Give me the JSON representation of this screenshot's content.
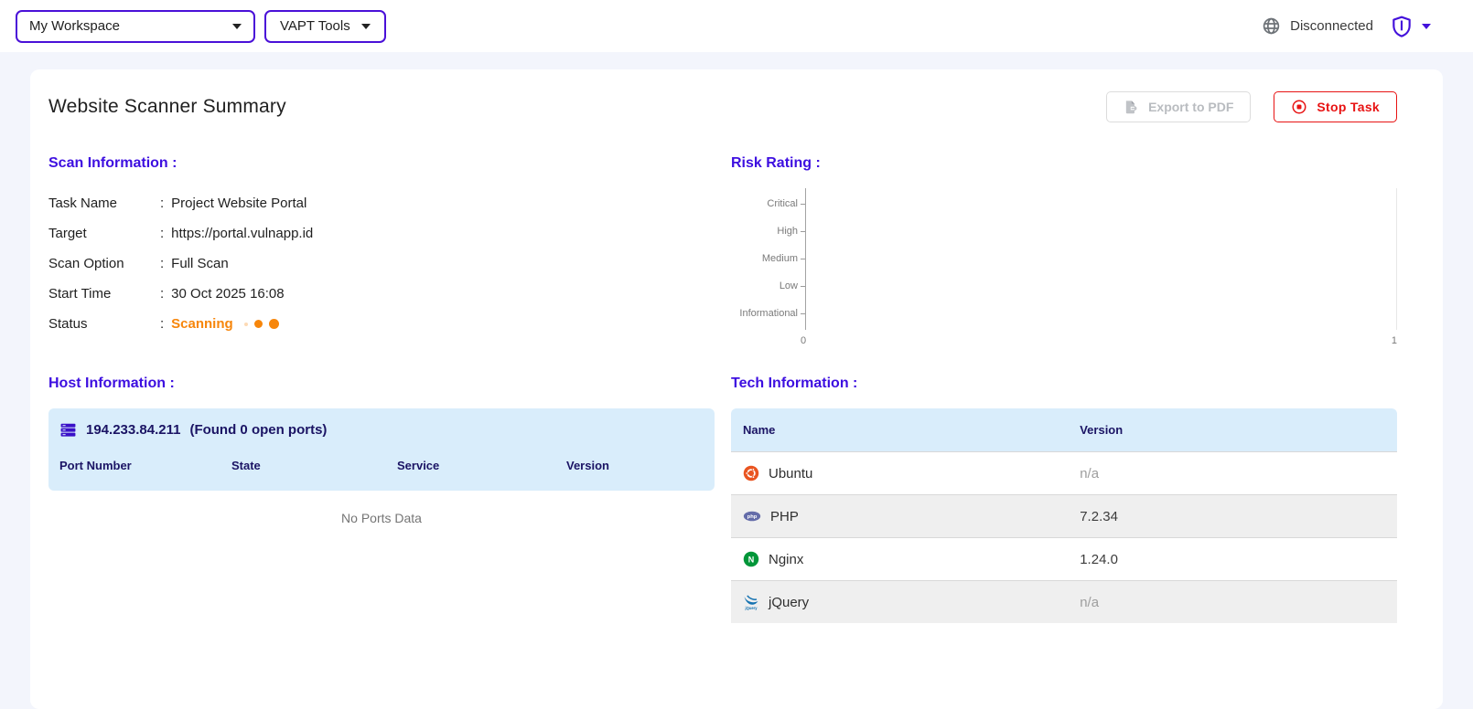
{
  "topbar": {
    "workspace_select": {
      "value": "My Workspace",
      "icon": "chevron-down-icon"
    },
    "vapt_tools_button": {
      "label": "VAPT Tools",
      "icon": "chevron-down-icon"
    },
    "connection": {
      "icon": "globe-icon",
      "status": "Disconnected"
    },
    "account_menu": {
      "icon": "shield-icon",
      "chevron": "chevron-down-icon"
    }
  },
  "header": {
    "title": "Website Scanner Summary",
    "export_button": {
      "label": "Export to PDF",
      "icon": "file-export-icon",
      "enabled": false
    },
    "stop_button": {
      "label": "Stop Task",
      "icon": "stop-circle-icon"
    }
  },
  "scan_info": {
    "heading": "Scan Information :",
    "separator": ":",
    "rows": [
      {
        "label": "Task Name",
        "value": "Project Website Portal"
      },
      {
        "label": "Target",
        "value": "https://portal.vulnapp.id"
      },
      {
        "label": "Scan Option",
        "value": "Full Scan"
      },
      {
        "label": "Start Time",
        "value": "30 Oct 2025 16:08"
      }
    ],
    "status": {
      "label": "Status",
      "value": "Scanning",
      "color": "#f7860b",
      "loader": "three-dots"
    }
  },
  "risk_rating": {
    "heading": "Risk Rating :"
  },
  "chart_data": {
    "type": "bar",
    "orientation": "horizontal",
    "title": "Risk Rating :",
    "categories": [
      "Critical",
      "High",
      "Medium",
      "Low",
      "Informational"
    ],
    "values": [
      0,
      0,
      0,
      0,
      0
    ],
    "xlabel": "",
    "ylabel": "",
    "xlim": [
      0,
      1
    ],
    "x_ticks": [
      "0",
      "1"
    ],
    "grid": false,
    "legend": false
  },
  "host_info": {
    "heading": "Host Information :",
    "host": {
      "icon": "server-icon",
      "ip": "194.233.84.211",
      "note": "(Found 0 open ports)"
    },
    "columns": [
      "Port Number",
      "State",
      "Service",
      "Version"
    ],
    "empty_text": "No Ports Data"
  },
  "tech_info": {
    "heading": "Tech Information :",
    "columns": [
      "Name",
      "Version"
    ],
    "rows": [
      {
        "icon": "ubuntu-icon",
        "name": "Ubuntu",
        "version": "n/a"
      },
      {
        "icon": "php-icon",
        "name": "PHP",
        "version": "7.2.34"
      },
      {
        "icon": "nginx-icon",
        "name": "Nginx",
        "version": "1.24.0"
      },
      {
        "icon": "jquery-icon",
        "name": "jQuery",
        "version": "n/a"
      }
    ]
  },
  "colors": {
    "accent_purple": "#4311db",
    "heading_purple": "#3d0ee0",
    "table_header_navy": "#1b1464",
    "panel_blue": "#d9edfb",
    "status_orange": "#f7860b",
    "danger_red": "#e81313",
    "muted_gray": "#9e9e9e"
  }
}
